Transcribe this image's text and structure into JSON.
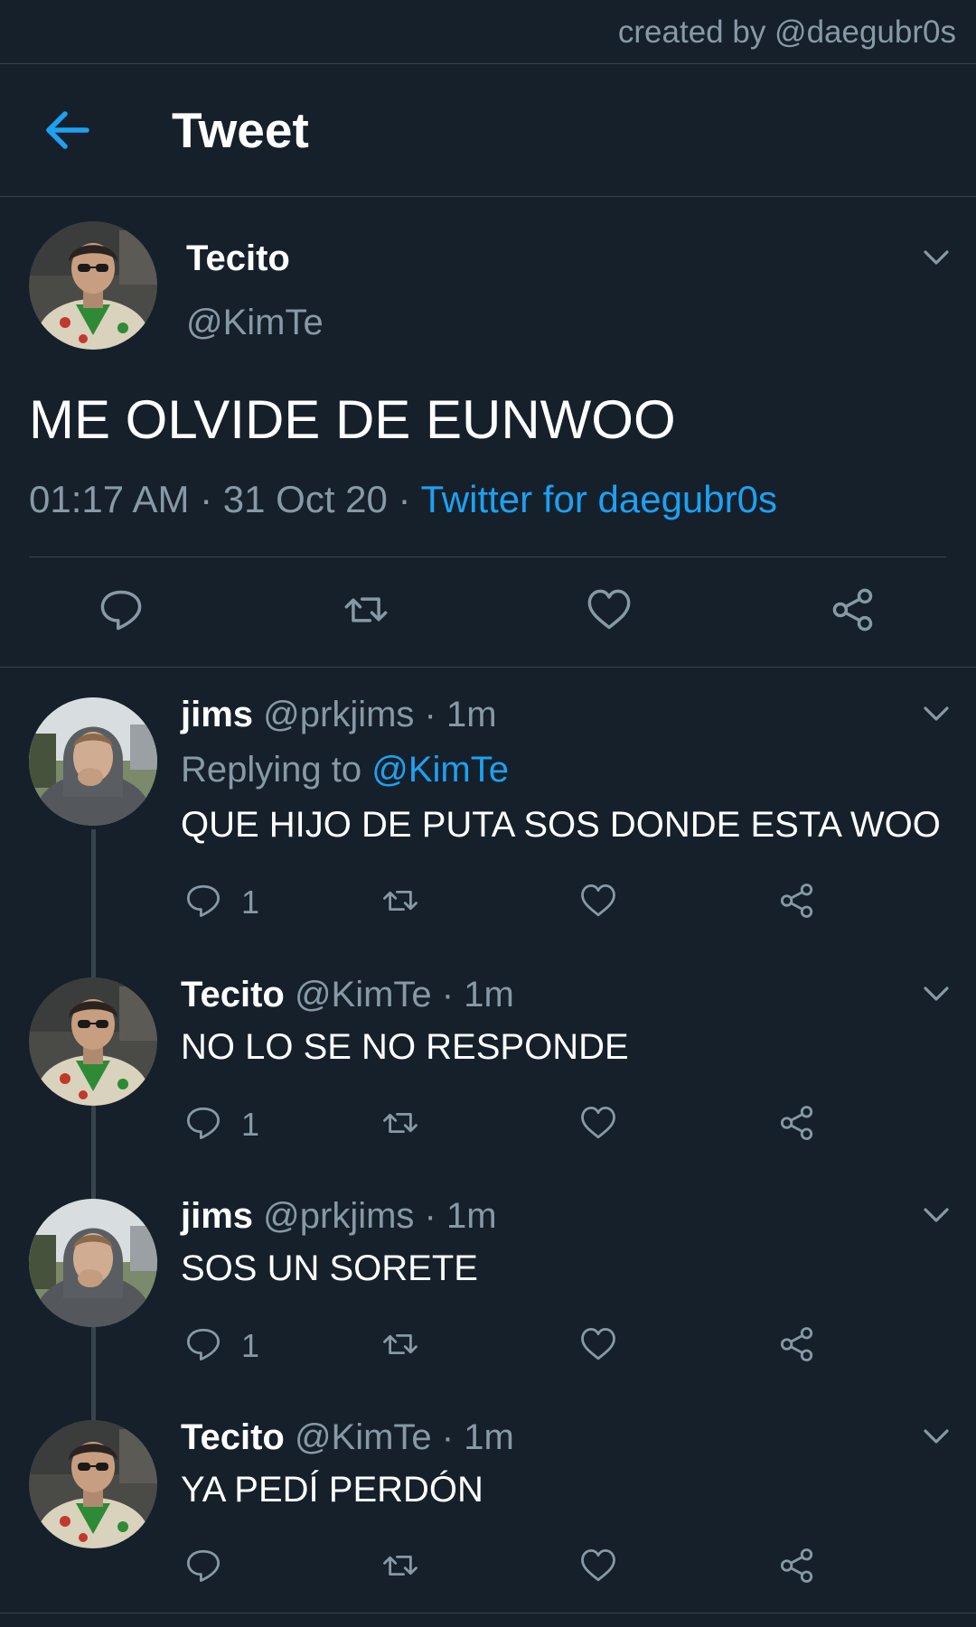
{
  "watermark": "created by @daegubr0s",
  "header": {
    "title": "Tweet"
  },
  "main_tweet": {
    "name": "Tecito",
    "handle": "@KimTe",
    "text": "ME OLVIDE DE EUNWOO",
    "time": "01:17 AM · 31 Oct 20 · ",
    "source": "Twitter for daegubr0s"
  },
  "replies": [
    {
      "name": "jims",
      "handle_time": " @prkjims · 1m",
      "replying_prefix": "Replying to ",
      "replying_to": "@KimTe",
      "text": "QUE HIJO DE PUTA SOS DONDE ESTA WOO",
      "reply_count": "1"
    },
    {
      "name": "Tecito",
      "handle_time": " @KimTe · 1m",
      "text": "NO LO SE NO RESPONDE",
      "reply_count": "1"
    },
    {
      "name": "jims",
      "handle_time": " @prkjims · 1m",
      "text": "SOS UN SORETE",
      "reply_count": "1"
    },
    {
      "name": "Tecito",
      "handle_time": " @KimTe · 1m",
      "text": "YA PEDÍ PERDÓN",
      "reply_count": ""
    }
  ],
  "icons": {
    "back": "arrow-left-icon",
    "reply": "speech-bubble-icon",
    "retweet": "retweet-icon",
    "like": "heart-icon",
    "share": "share-icon",
    "caret": "chevron-down-icon"
  },
  "colors": {
    "background": "#15202b",
    "accent": "#1da1f2",
    "muted": "#8899a6",
    "divider": "#38444d"
  }
}
